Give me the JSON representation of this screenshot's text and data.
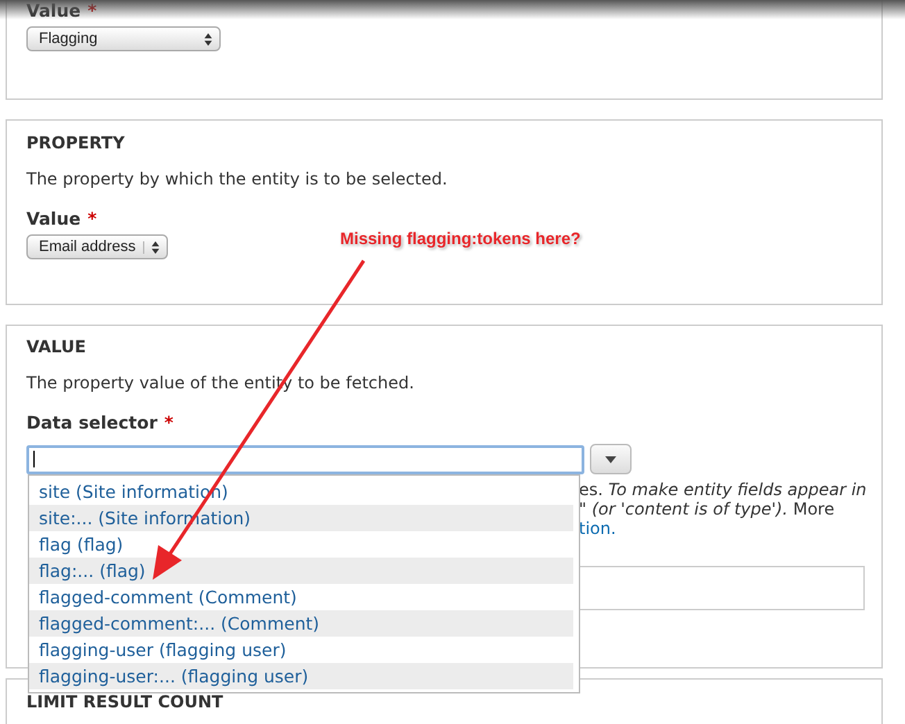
{
  "top_section": {
    "label": "Value",
    "required_mark": "*",
    "select": "Flagging"
  },
  "property_section": {
    "heading": "PROPERTY",
    "description": "The property by which the entity is to be selected.",
    "label": "Value",
    "required_mark": "*",
    "select": "Email address"
  },
  "value_section": {
    "heading": "VALUE",
    "description": "The property value of the entity to be fetched.",
    "label": "Data selector",
    "required_mark": "*",
    "autocomplete": [
      {
        "label": "site (Site information)"
      },
      {
        "label": "site:... (Site information)"
      },
      {
        "label": "flag (flag)"
      },
      {
        "label": "flag:... (flag)"
      },
      {
        "label": "flagged-comment (Comment)"
      },
      {
        "label": "flagged-comment:... (Comment)"
      },
      {
        "label": "flagging-user (flagging user)"
      },
      {
        "label": "flagging-user:... (flagging user)"
      }
    ],
    "help_lines": [
      {
        "kind": "text",
        "text": "es. *To make entity fields appear in*"
      },
      {
        "kind": "text",
        "text": "*\" (or 'content is of type').* More"
      },
      {
        "kind": "link",
        "text": "tion."
      }
    ]
  },
  "limit_section": {
    "heading": "LIMIT RESULT COUNT"
  },
  "annotation": {
    "text": "Missing flagging:tokens here?"
  }
}
